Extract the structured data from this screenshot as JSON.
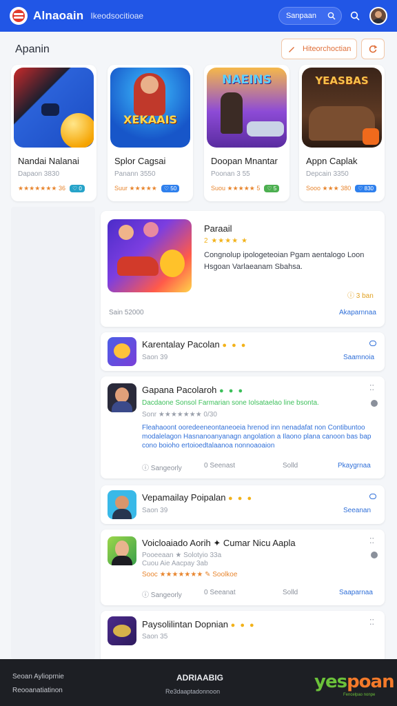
{
  "header": {
    "brand": "Alnaoain",
    "subbrand": "Ikeodsocitioae",
    "search_label": "Sanpaan",
    "brand_color": "#2156e6"
  },
  "section": {
    "title": "Apanin",
    "filter_label": "Hiteorchoctian"
  },
  "featured": [
    {
      "name": "Nandai Nalanai",
      "meta": "Dapaon 3830",
      "rating": "★★★★★★★ 36",
      "badge": "♡ 0"
    },
    {
      "name": "Splor Cagsai",
      "meta": "Panann 3550",
      "rating": "Suur ★★★★★",
      "badge": "♡ 50",
      "art_text": "XEKAAIS"
    },
    {
      "name": "Doopan Mnantar",
      "meta": "Poonan 3 55",
      "rating": "Suou ★★★★★ 5",
      "badge": "♡ 5",
      "art_text": "NAEINS"
    },
    {
      "name": "Appn Caplak",
      "meta": "Depcain 3350",
      "rating": "Sooo ★★★ 380",
      "badge": "♡ 830",
      "art_text": "YEASBAS"
    }
  ],
  "cards": {
    "promo": {
      "title": "Paraail",
      "rating": "2 ★★★★ ★",
      "description": "Congnolup ipologeteoian  Pgam  aentalogo Loon Hsgoan Varlaeanam Sbahsa.",
      "coins": "ⓘ 3 ban",
      "footer_left": "Sain 52000",
      "footer_link": "Akaparnnaa"
    },
    "item1": {
      "title": "Karentalay Pacolan",
      "sub": "Saon 39",
      "link": "Saamnoia"
    },
    "item2": {
      "title": "Gapana Pacolaroh",
      "sub1": "Dacdaone  Sonsol Farmarian  sone Iolsataelao  line  bsonta.",
      "sub2": "Sonr  ★★★★★★★  0/30",
      "blue_text": "Fleahaoont ooredeeneontaneoeia  hrenod  inn nenadafat non Contibuntoo modalelagon Hasnanoanyanagn angolation a Ilaono plana canoon bas bap cono boioho ertoioedtalaanoa  nonnoaoaion",
      "stat1": "ⓘ  Sangeorly",
      "stat2": "0  Seenast",
      "stat3": "Solld",
      "link": "Pkaygrnaa"
    },
    "item3": {
      "title": "Vepamailay Poipalan",
      "sub": "Saon 39",
      "link": "Seeanan"
    },
    "item4": {
      "title": "Voicloaiado Aorih ✦ Cumar Nicu Aapla",
      "sub1": "Pooeeaan ★ Solotyio  33a",
      "sub2": "Cuou Aie  Aacpay  3ab",
      "rating": "Sooc ★★★★★★★ ✎ Soolkoe",
      "stat1": "ⓘ  Sangeorly",
      "stat2": "0  Seeanat",
      "stat3": "Solld",
      "link": "Saaparnaa"
    },
    "item5": {
      "title": "Paysolilintan Dopnian",
      "sub": "Saon 35"
    }
  },
  "footer": {
    "left1": "Seoan Aylioprnie",
    "left2": "Reooanatiatinon",
    "center": "ADRIAABIG",
    "center_sub": "Re3daaptadonnoon",
    "logo_a": "yes",
    "logo_b": "poan",
    "logo_sub": "Fencelpao nonpe"
  }
}
